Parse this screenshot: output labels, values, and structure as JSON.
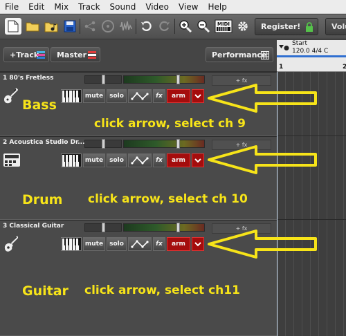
{
  "menu": [
    "File",
    "Edit",
    "Mix",
    "Track",
    "Sound",
    "Video",
    "View",
    "Help"
  ],
  "toolbar": {
    "register_label": "Register!",
    "volume_label": "Volume"
  },
  "header": {
    "add_track_label": "+Track",
    "master_label": "Master",
    "performance_label": "Performance"
  },
  "timeline": {
    "start_label": "Start",
    "tempo": "120.0 4/4 C",
    "bar1": "1",
    "bar2": "2"
  },
  "tracks": [
    {
      "name": "1 80's Fretless",
      "fx_label": "+ fx",
      "mute": "mute",
      "solo": "solo",
      "fx": "fx",
      "arm": "arm",
      "annot_label": "Bass",
      "annot_note": "click arrow, select ch 9"
    },
    {
      "name": "2 Acoustica Studio Dr...",
      "fx_label": "+ fx",
      "mute": "mute",
      "solo": "solo",
      "fx": "fx",
      "arm": "arm",
      "annot_label": "Drum",
      "annot_note": "click arrow, select ch 10"
    },
    {
      "name": "3 Classical Guitar",
      "fx_label": "+ fx",
      "mute": "mute",
      "solo": "solo",
      "fx": "fx",
      "arm": "arm",
      "annot_label": "Guitar",
      "annot_note": "click arrow, select ch11"
    }
  ],
  "colors": {
    "arm_red": "#a40d0d",
    "annotation_yellow": "#f7e419",
    "loop_blue": "#2f6fd1"
  }
}
